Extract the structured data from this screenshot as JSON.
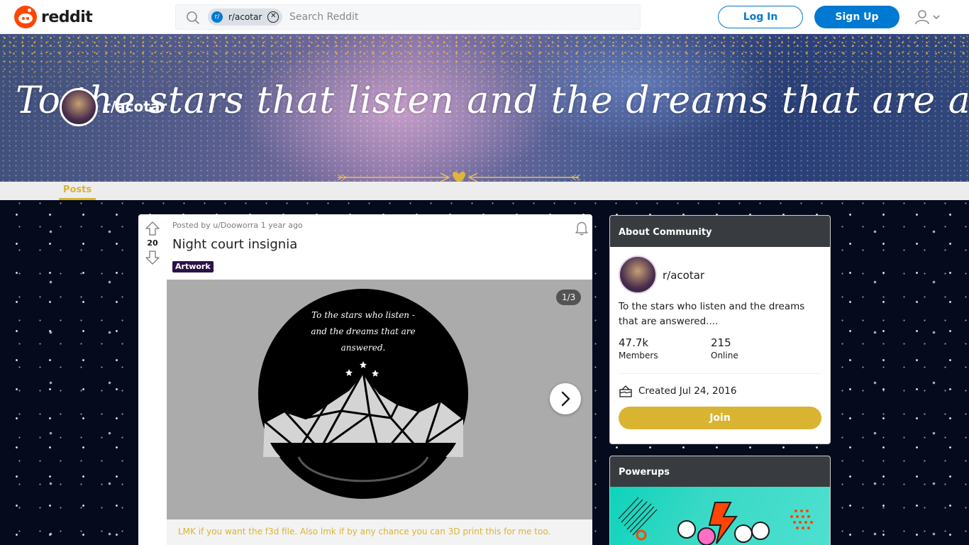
{
  "header": {
    "logo_text": "reddit",
    "search": {
      "chip_label": "r/acotar",
      "chip_avatar": "r/",
      "placeholder": "Search Reddit"
    },
    "login_label": "Log In",
    "signup_label": "Sign Up",
    "icons": [
      "reddit-logo-icon",
      "search-icon",
      "close-circle-icon",
      "user-icon",
      "chevron-down-icon"
    ]
  },
  "banner": {
    "text": "To the stars that listen and the dreams that are answered",
    "subreddit_name": "r/acotar"
  },
  "nav": {
    "tabs": [
      {
        "label": "Posts",
        "active": true
      }
    ]
  },
  "post": {
    "score": "20",
    "meta": "Posted by u/Dooworra 1 year ago",
    "title": "Night court insignia",
    "flair": "Artwork",
    "gallery_counter": "1/3",
    "image_text": [
      "To the stars who listen -",
      "and the dreams that are",
      "answered."
    ],
    "caption": "LMK if you want the f3d file. Also lmk if by any chance you can 3D print this for me too."
  },
  "sidebar": {
    "about": {
      "heading": "About Community",
      "name": "r/acotar",
      "description": "To the stars who listen and the dreams that are answered....",
      "members_value": "47.7k",
      "members_label": "Members",
      "online_value": "215",
      "online_label": "Online",
      "created": "Created Jul 24, 2016",
      "join_label": "Join"
    },
    "powerups": {
      "heading": "Powerups"
    }
  },
  "colors": {
    "brand_blue": "#0079d3",
    "reddit_orange": "#ff4500",
    "community_gold": "#d9b431",
    "widget_header": "#383c40",
    "flair_bg": "#2c1247"
  }
}
